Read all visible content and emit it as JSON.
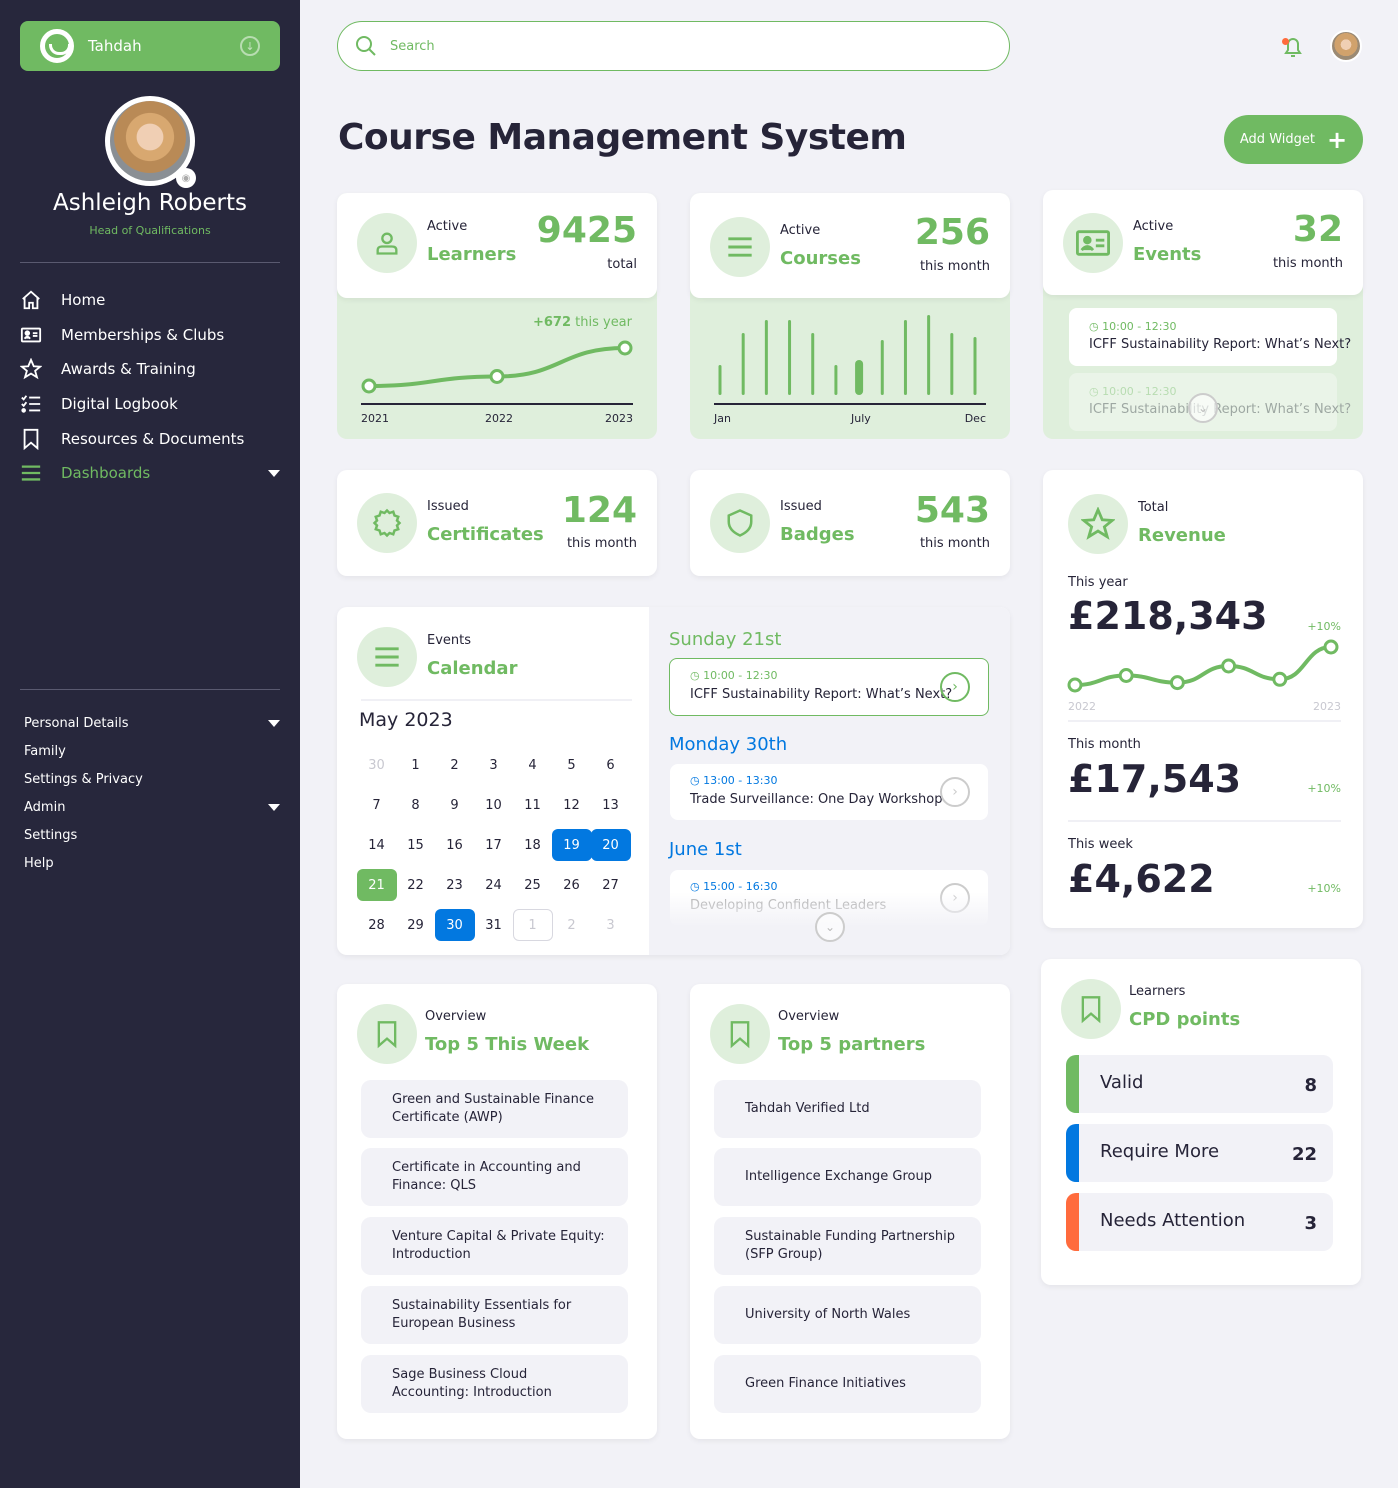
{
  "brand": {
    "name": "Tahdah"
  },
  "user": {
    "name": "Ashleigh Roberts",
    "role": "Head of Qualifications"
  },
  "nav": {
    "items": [
      {
        "label": "Home",
        "icon": "home-icon"
      },
      {
        "label": "Memberships & Clubs",
        "icon": "id-card-icon"
      },
      {
        "label": "Awards & Training",
        "icon": "star-icon"
      },
      {
        "label": "Digital Logbook",
        "icon": "checklist-icon"
      },
      {
        "label": "Resources & Documents",
        "icon": "bookmark-icon"
      },
      {
        "label": "Dashboards",
        "icon": "menu-icon",
        "active": true
      }
    ],
    "secondary": [
      {
        "label": "Personal Details"
      },
      {
        "label": "Family"
      },
      {
        "label": "Settings & Privacy"
      },
      {
        "label": "Admin"
      },
      {
        "label": "Settings"
      },
      {
        "label": "Help"
      }
    ]
  },
  "search": {
    "placeholder": "Search"
  },
  "page": {
    "title": "Course Management System",
    "add_widget": "Add Widget"
  },
  "colors": {
    "accent": "#70ba62",
    "accent_light": "#dfefdc",
    "blue": "#0278e0",
    "orange": "#ff6b3d",
    "sidebar": "#27273c",
    "text": "#262438"
  },
  "learners": {
    "subtitle": "Active",
    "title": "Learners",
    "value": "9425",
    "unit": "total",
    "delta_value": "+672",
    "delta_label": "this year",
    "chart_data": {
      "type": "line",
      "x": [
        "2021",
        "2022",
        "2023"
      ],
      "values": [
        1,
        2,
        5
      ],
      "tick_labels": [
        "2021",
        "2022",
        "2023"
      ]
    }
  },
  "courses": {
    "subtitle": "Active",
    "title": "Courses",
    "value": "256",
    "unit": "this month",
    "chart_data": {
      "type": "bar",
      "categories": [
        "Jan",
        "Feb",
        "Mar",
        "Apr",
        "May",
        "Jun",
        "Jul",
        "Aug",
        "Sep",
        "Oct",
        "Nov",
        "Dec"
      ],
      "values": [
        30,
        62,
        75,
        75,
        62,
        30,
        35,
        55,
        75,
        80,
        62,
        58
      ],
      "highlight_index": 6,
      "tick_labels": [
        "Jan",
        "July",
        "Dec"
      ]
    }
  },
  "events": {
    "subtitle": "Active",
    "title": "Events",
    "value": "32",
    "unit": "this month",
    "items": [
      {
        "time": "10:00 - 12:30",
        "name": "ICFF Sustainability Report: What’s Next?"
      },
      {
        "time": "10:00 - 12:30",
        "name": "ICFF Sustainability Report: What’s Next?"
      }
    ]
  },
  "certificates": {
    "subtitle": "Issued",
    "title": "Certificates",
    "value": "124",
    "unit": "this month"
  },
  "badges": {
    "subtitle": "Issued",
    "title": "Badges",
    "value": "543",
    "unit": "this month"
  },
  "revenue": {
    "subtitle": "Total",
    "title": "Revenue",
    "year_label": "This year",
    "year_value": "£218,343",
    "year_pct": "+10%",
    "month_label": "This month",
    "month_value": "£17,543",
    "month_pct": "+10%",
    "week_label": "This week",
    "week_value": "£4,622",
    "week_pct": "+10%",
    "chart_data": {
      "type": "line",
      "x_start": "2022",
      "x_end": "2023",
      "values": [
        1,
        3,
        1.5,
        5,
        2.2,
        9
      ]
    }
  },
  "calendar": {
    "subtitle": "Events",
    "title": "Calendar",
    "month": "May 2023",
    "weeks": [
      [
        {
          "d": "30",
          "s": "muted"
        },
        {
          "d": "1"
        },
        {
          "d": "2"
        },
        {
          "d": "3"
        },
        {
          "d": "4"
        },
        {
          "d": "5"
        },
        {
          "d": "6"
        }
      ],
      [
        {
          "d": "7"
        },
        {
          "d": "8"
        },
        {
          "d": "9"
        },
        {
          "d": "10"
        },
        {
          "d": "11"
        },
        {
          "d": "12"
        },
        {
          "d": "13"
        }
      ],
      [
        {
          "d": "14"
        },
        {
          "d": "15"
        },
        {
          "d": "16"
        },
        {
          "d": "17"
        },
        {
          "d": "18"
        },
        {
          "d": "19",
          "s": "blue"
        },
        {
          "d": "20",
          "s": "blue"
        }
      ],
      [
        {
          "d": "21",
          "s": "green"
        },
        {
          "d": "22"
        },
        {
          "d": "23"
        },
        {
          "d": "24"
        },
        {
          "d": "25"
        },
        {
          "d": "26"
        },
        {
          "d": "27"
        }
      ],
      [
        {
          "d": "28"
        },
        {
          "d": "29"
        },
        {
          "d": "30",
          "s": "blue"
        },
        {
          "d": "31"
        },
        {
          "d": "1",
          "s": "outlined"
        },
        {
          "d": "2",
          "s": "muted"
        },
        {
          "d": "3",
          "s": "muted"
        }
      ]
    ],
    "agenda": [
      {
        "day": "Sunday 21st",
        "time": "10:00 - 12:30",
        "name": "ICFF Sustainability Report: What’s Next?",
        "tone": "green"
      },
      {
        "day": "Monday 30th",
        "time": "13:00 - 13:30",
        "name": "Trade Surveillance: One Day Workshop",
        "tone": "blue"
      },
      {
        "day": "June 1st",
        "time": "15:00 - 16:30",
        "name": "Developing Confident Leaders",
        "tone": "blue"
      }
    ]
  },
  "top_week": {
    "subtitle": "Overview",
    "title": "Top 5 This Week",
    "items": [
      "Green and Sustainable Finance Certificate (AWP)",
      "Certificate in Accounting and Finance: QLS",
      "Venture Capital & Private Equity: Introduction",
      "Sustainability Essentials for European Business",
      "Sage Business Cloud Accounting: Introduction"
    ]
  },
  "top_partners": {
    "subtitle": "Overview",
    "title": "Top 5 partners",
    "items": [
      "Tahdah Verified Ltd",
      "Intelligence Exchange Group",
      "Sustainable Funding Partnership (SFP Group)",
      "University of North Wales",
      "Green Finance Initiatives"
    ]
  },
  "cpd": {
    "subtitle": "Learners",
    "title": "CPD points",
    "items": [
      {
        "label": "Valid",
        "value": "8",
        "color": "#70ba62"
      },
      {
        "label": "Require More",
        "value": "22",
        "color": "#0278e0"
      },
      {
        "label": "Needs Attention",
        "value": "3",
        "color": "#ff6b3d"
      }
    ]
  }
}
